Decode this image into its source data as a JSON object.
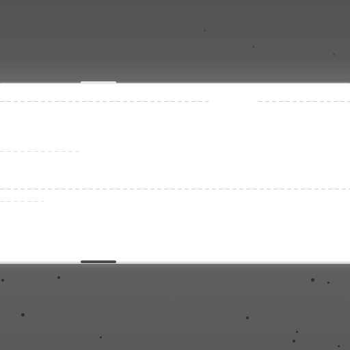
{
  "image": {
    "colors": {
      "background_gray": "#555555",
      "band_white": "#ffffff",
      "dash_line": "#c9c9c9",
      "speck": "#2e2e2e"
    }
  }
}
